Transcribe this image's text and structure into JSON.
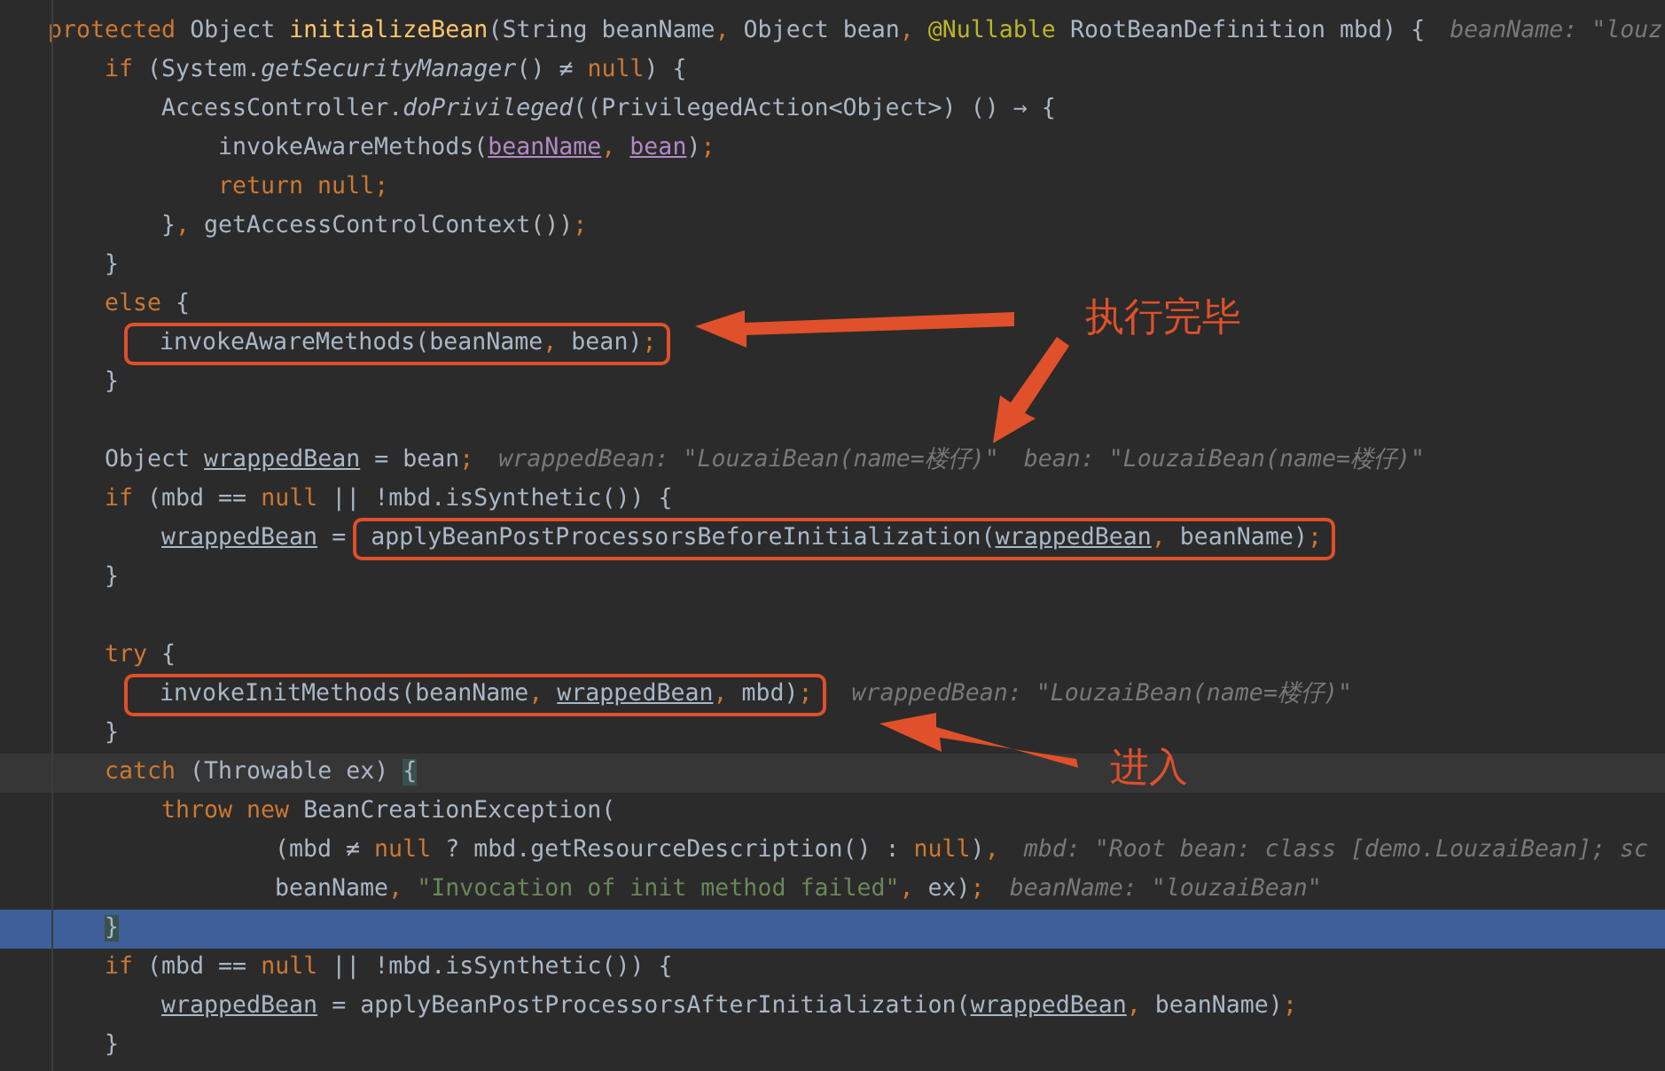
{
  "editor": {
    "lines": [
      {
        "kind": "code",
        "current": false,
        "execution": false,
        "tokens": [
          {
            "text": "protected ",
            "kind": "kw"
          },
          {
            "text": "Object ",
            "kind": "plain"
          },
          {
            "text": "initializeBean",
            "kind": "fn"
          },
          {
            "text": "(String beanName",
            "kind": "plain"
          },
          {
            "text": ", ",
            "kind": "punct"
          },
          {
            "text": "Object bean",
            "kind": "plain"
          },
          {
            "text": ", ",
            "kind": "punct"
          },
          {
            "text": "@Nullable",
            "kind": "anno"
          },
          {
            "text": " RootBeanDefinition mbd) {",
            "kind": "plain"
          }
        ],
        "hints": [
          "beanName: \"louz"
        ],
        "children": [
          {
            "kind": "code",
            "current": false,
            "execution": false,
            "tokens": [
              {
                "text": "if",
                "kind": "kw"
              },
              {
                "text": " (System.",
                "kind": "plain"
              },
              {
                "text": "getSecurityManager",
                "kind": "static"
              },
              {
                "text": "() ≠ ",
                "kind": "plain"
              },
              {
                "text": "null",
                "kind": "kw"
              },
              {
                "text": ") {",
                "kind": "plain"
              }
            ],
            "children": [
              {
                "kind": "code",
                "current": false,
                "execution": false,
                "tokens": [
                  {
                    "text": "AccessController.",
                    "kind": "plain"
                  },
                  {
                    "text": "doPrivileged",
                    "kind": "static"
                  },
                  {
                    "text": "((PrivilegedAction<Object>) () → {",
                    "kind": "plain"
                  }
                ],
                "children": [
                  {
                    "kind": "code",
                    "current": false,
                    "execution": false,
                    "tokens": [
                      {
                        "text": "invokeAwareMethods(",
                        "kind": "plain"
                      },
                      {
                        "text": "beanName",
                        "kind": "captured"
                      },
                      {
                        "text": ", ",
                        "kind": "punct"
                      },
                      {
                        "text": "bean",
                        "kind": "captured"
                      },
                      {
                        "text": ")",
                        "kind": "plain"
                      },
                      {
                        "text": ";",
                        "kind": "punct"
                      }
                    ]
                  },
                  {
                    "kind": "code",
                    "current": false,
                    "execution": false,
                    "tokens": [
                      {
                        "text": "return null",
                        "kind": "kw"
                      },
                      {
                        "text": ";",
                        "kind": "punct"
                      }
                    ]
                  }
                ]
              },
              {
                "kind": "code",
                "current": false,
                "execution": false,
                "tokens": [
                  {
                    "text": "}",
                    "kind": "plain"
                  },
                  {
                    "text": ", ",
                    "kind": "punct"
                  },
                  {
                    "text": "getAccessControlContext())",
                    "kind": "plain"
                  },
                  {
                    "text": ";",
                    "kind": "punct"
                  }
                ]
              }
            ]
          },
          {
            "kind": "code",
            "current": false,
            "execution": false,
            "tokens": [
              {
                "text": "}",
                "kind": "plain"
              }
            ]
          },
          {
            "kind": "code",
            "current": false,
            "execution": false,
            "tokens": [
              {
                "text": "else",
                "kind": "kw"
              },
              {
                "text": " {",
                "kind": "plain"
              }
            ],
            "children": [
              {
                "kind": "code",
                "current": false,
                "execution": false,
                "framed_tokens": [
                  {
                    "text": "invokeAwareMethods(beanName",
                    "kind": "plain"
                  },
                  {
                    "text": ", ",
                    "kind": "punct"
                  },
                  {
                    "text": "bean)",
                    "kind": "plain"
                  },
                  {
                    "text": ";",
                    "kind": "punct"
                  }
                ]
              }
            ]
          },
          {
            "kind": "code",
            "current": false,
            "execution": false,
            "tokens": [
              {
                "text": "}",
                "kind": "plain"
              }
            ]
          },
          {
            "kind": "blank"
          },
          {
            "kind": "code",
            "current": false,
            "execution": false,
            "tokens": [
              {
                "text": "Object ",
                "kind": "plain"
              },
              {
                "text": "wrappedBean",
                "kind": "reassigned"
              },
              {
                "text": " = bean",
                "kind": "plain"
              },
              {
                "text": ";",
                "kind": "punct"
              }
            ],
            "hints": [
              "wrappedBean: \"LouzaiBean(name=楼仔)\"",
              "bean: \"LouzaiBean(name=楼仔)\""
            ]
          },
          {
            "kind": "code",
            "current": false,
            "execution": false,
            "tokens": [
              {
                "text": "if",
                "kind": "kw"
              },
              {
                "text": " (mbd == ",
                "kind": "plain"
              },
              {
                "text": "null",
                "kind": "kw"
              },
              {
                "text": " || !mbd.isSynthetic()) {",
                "kind": "plain"
              }
            ],
            "children": [
              {
                "kind": "code",
                "current": false,
                "execution": false,
                "tokens": [
                  {
                    "text": "wrappedBean",
                    "kind": "reassigned"
                  },
                  {
                    "text": " =",
                    "kind": "plain"
                  }
                ],
                "framed_tokens": [
                  {
                    "text": "applyBeanPostProcessorsBeforeInitialization(",
                    "kind": "plain"
                  },
                  {
                    "text": "wrappedBean",
                    "kind": "reassigned"
                  },
                  {
                    "text": ", ",
                    "kind": "punct"
                  },
                  {
                    "text": "beanName)",
                    "kind": "plain"
                  },
                  {
                    "text": ";",
                    "kind": "punct"
                  }
                ]
              }
            ]
          },
          {
            "kind": "code",
            "current": false,
            "execution": false,
            "tokens": [
              {
                "text": "}",
                "kind": "plain"
              }
            ]
          },
          {
            "kind": "blank"
          },
          {
            "kind": "code",
            "current": false,
            "execution": false,
            "tokens": [
              {
                "text": "try",
                "kind": "kw"
              },
              {
                "text": " {",
                "kind": "plain"
              }
            ],
            "children": [
              {
                "kind": "code",
                "current": false,
                "execution": false,
                "framed_tokens": [
                  {
                    "text": "invokeInitMethods(beanName",
                    "kind": "plain"
                  },
                  {
                    "text": ", ",
                    "kind": "punct"
                  },
                  {
                    "text": "wrappedBean",
                    "kind": "reassigned"
                  },
                  {
                    "text": ", ",
                    "kind": "punct"
                  },
                  {
                    "text": "mbd)",
                    "kind": "plain"
                  },
                  {
                    "text": ";",
                    "kind": "punct"
                  }
                ],
                "hints": [
                  "wrappedBean: \"LouzaiBean(name=楼仔)\""
                ]
              }
            ]
          },
          {
            "kind": "code",
            "current": false,
            "execution": false,
            "tokens": [
              {
                "text": "}",
                "kind": "plain"
              }
            ]
          },
          {
            "kind": "code",
            "current": true,
            "execution": false,
            "tokens": [
              {
                "text": "catch",
                "kind": "kw"
              },
              {
                "text": " (Throwable ex) ",
                "kind": "plain"
              },
              {
                "text": "{",
                "kind": "brace"
              }
            ],
            "children": [
              {
                "kind": "code",
                "current": false,
                "execution": false,
                "tokens": [
                  {
                    "text": "throw new",
                    "kind": "kw"
                  },
                  {
                    "text": " BeanCreationException(",
                    "kind": "plain"
                  }
                ],
                "children": [
                  {
                    "kind": "continuation",
                    "current": false,
                    "execution": false,
                    "tokens": [
                      {
                        "text": "(mbd ≠ ",
                        "kind": "plain"
                      },
                      {
                        "text": "null",
                        "kind": "kw"
                      },
                      {
                        "text": " ? mbd.getResourceDescription() : ",
                        "kind": "plain"
                      },
                      {
                        "text": "null",
                        "kind": "kw"
                      },
                      {
                        "text": ")",
                        "kind": "plain"
                      },
                      {
                        "text": ",",
                        "kind": "punct"
                      }
                    ],
                    "hints": [
                      "mbd: \"Root bean: class [demo.LouzaiBean]; sc"
                    ]
                  },
                  {
                    "kind": "continuation",
                    "current": false,
                    "execution": false,
                    "tokens": [
                      {
                        "text": "beanName",
                        "kind": "plain"
                      },
                      {
                        "text": ", ",
                        "kind": "punct"
                      },
                      {
                        "text": "\"Invocation of init method failed\"",
                        "kind": "str"
                      },
                      {
                        "text": ", ",
                        "kind": "punct"
                      },
                      {
                        "text": "ex)",
                        "kind": "plain"
                      },
                      {
                        "text": ";",
                        "kind": "punct"
                      }
                    ],
                    "hints": [
                      "beanName: \"louzaiBean\""
                    ]
                  }
                ]
              }
            ]
          },
          {
            "kind": "code",
            "current": false,
            "execution": true,
            "tokens": [
              {
                "text": "}",
                "kind": "brace"
              }
            ]
          },
          {
            "kind": "code",
            "current": false,
            "execution": false,
            "tokens": [
              {
                "text": "if",
                "kind": "kw"
              },
              {
                "text": " (mbd == ",
                "kind": "plain"
              },
              {
                "text": "null",
                "kind": "kw"
              },
              {
                "text": " || !mbd.isSynthetic()) {",
                "kind": "plain"
              }
            ],
            "children": [
              {
                "kind": "code",
                "current": false,
                "execution": false,
                "tokens": [
                  {
                    "text": "wrappedBean",
                    "kind": "reassigned"
                  },
                  {
                    "text": " = applyBeanPostProcessorsAfterInitialization(",
                    "kind": "plain"
                  },
                  {
                    "text": "wrappedBean",
                    "kind": "reassigned"
                  },
                  {
                    "text": ", ",
                    "kind": "punct"
                  },
                  {
                    "text": "beanName)",
                    "kind": "plain"
                  },
                  {
                    "text": ";",
                    "kind": "punct"
                  }
                ]
              }
            ]
          },
          {
            "kind": "code",
            "current": false,
            "execution": false,
            "tokens": [
              {
                "text": "}",
                "kind": "plain"
              }
            ]
          }
        ]
      }
    ]
  },
  "annotations": {
    "labels": [
      "执行完毕",
      "进入"
    ]
  }
}
